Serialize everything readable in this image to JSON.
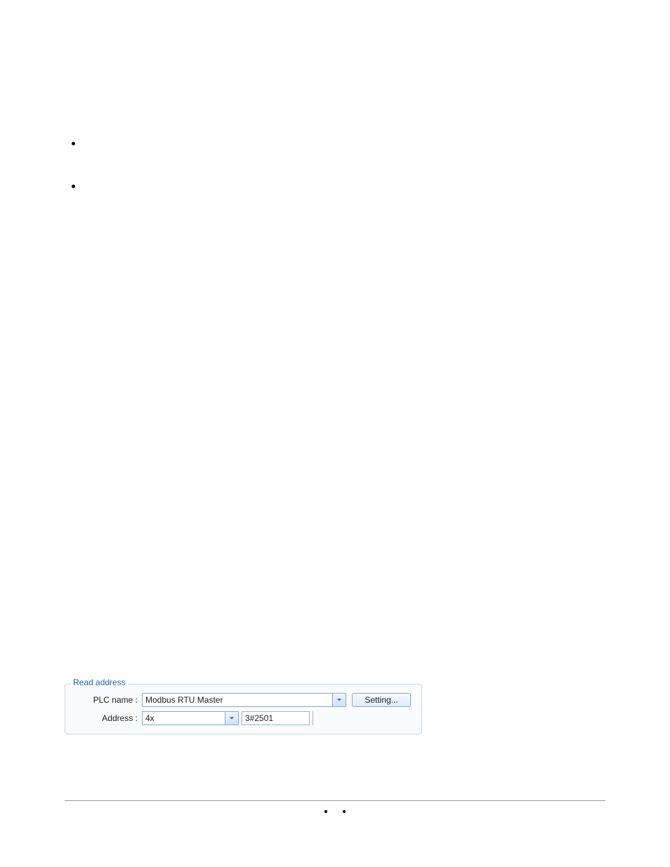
{
  "read_address": {
    "legend": "Read address",
    "plc_label": "PLC name :",
    "plc_value": "Modbus RTU Master",
    "addr_label": "Address :",
    "addr_type_value": "4x",
    "addr_value": "3#2501",
    "setting_label": "Setting..."
  }
}
